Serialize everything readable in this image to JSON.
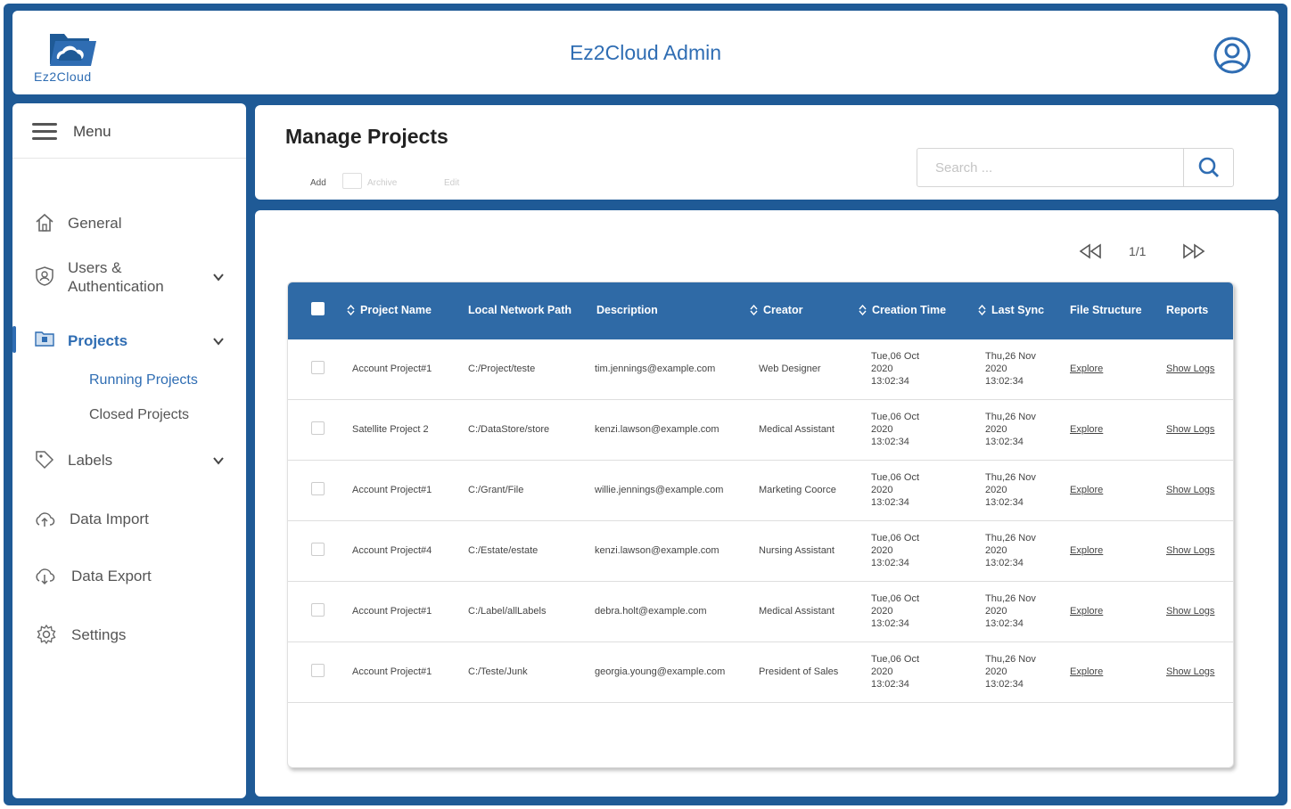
{
  "header": {
    "logo_text": "Ez2Cloud",
    "title": "Ez2Cloud Admin",
    "user_icon": "user-circle-icon"
  },
  "sidebar": {
    "menu_label": "Menu",
    "items": [
      {
        "label": "General",
        "icon": "home-icon"
      },
      {
        "label": "Users & Authentication",
        "icon": "shield-user-icon"
      },
      {
        "label": "Projects",
        "icon": "folder-icon"
      },
      {
        "label": "Labels",
        "icon": "tag-icon"
      },
      {
        "label": "Data Import",
        "icon": "cloud-upload-icon"
      },
      {
        "label": "Data Export",
        "icon": "cloud-download-icon"
      },
      {
        "label": "Settings",
        "icon": "gear-icon"
      }
    ],
    "projects_sub": [
      {
        "label": "Running Projects"
      },
      {
        "label": "Closed Projects"
      }
    ]
  },
  "page": {
    "title": "Manage Projects",
    "toolbar": {
      "add": "Add",
      "archive": "Archive",
      "edit": "Edit"
    },
    "search": {
      "placeholder": "Search ..."
    }
  },
  "pager": {
    "text": "1/1"
  },
  "table": {
    "columns": [
      "Project Name",
      "Local Network Path",
      "Description",
      "Creator",
      "Creation Time",
      "Last Sync",
      "File Structure",
      "Reports"
    ],
    "rows": [
      {
        "name": "Account Project#1",
        "path": "C:/Project/teste",
        "description": "tim.jennings@example.com",
        "creator": "Web Designer",
        "created": "Tue,06 Oct 2020 13:02:34",
        "synced": "Thu,26 Nov 2020 13:02:34",
        "structure": "Explore",
        "reports": "Show Logs"
      },
      {
        "name": "Satellite Project 2",
        "path": "C:/DataStore/store",
        "description": "kenzi.lawson@example.com",
        "creator": "Medical Assistant",
        "created": "Tue,06 Oct 2020 13:02:34",
        "synced": "Thu,26 Nov 2020 13:02:34",
        "structure": "Explore",
        "reports": "Show Logs"
      },
      {
        "name": "Account Project#1",
        "path": "C:/Grant/File",
        "description": "willie.jennings@example.com",
        "creator": "Marketing Coorce",
        "created": "Tue,06 Oct 2020 13:02:34",
        "synced": "Thu,26 Nov 2020 13:02:34",
        "structure": "Explore",
        "reports": "Show Logs"
      },
      {
        "name": "Account Project#4",
        "path": "C:/Estate/estate",
        "description": "kenzi.lawson@example.com",
        "creator": "Nursing Assistant",
        "created": "Tue,06 Oct 2020 13:02:34",
        "synced": "Thu,26 Nov 2020 13:02:34",
        "structure": "Explore",
        "reports": "Show Logs"
      },
      {
        "name": "Account Project#1",
        "path": "C:/Label/allLabels",
        "description": "debra.holt@example.com",
        "creator": "Medical Assistant",
        "created": "Tue,06 Oct 2020 13:02:34",
        "synced": "Thu,26 Nov 2020 13:02:34",
        "structure": "Explore",
        "reports": "Show Logs"
      },
      {
        "name": "Account Project#1",
        "path": "C:/Teste/Junk",
        "description": "georgia.young@example.com",
        "creator": "President of Sales",
        "created": "Tue,06 Oct 2020 13:02:34",
        "synced": "Thu,26 Nov 2020 13:02:34",
        "structure": "Explore",
        "reports": "Show Logs"
      }
    ]
  },
  "colors": {
    "brand": "#1f5a96",
    "accent": "#2f6db3",
    "table_header": "#2f6aa6"
  }
}
